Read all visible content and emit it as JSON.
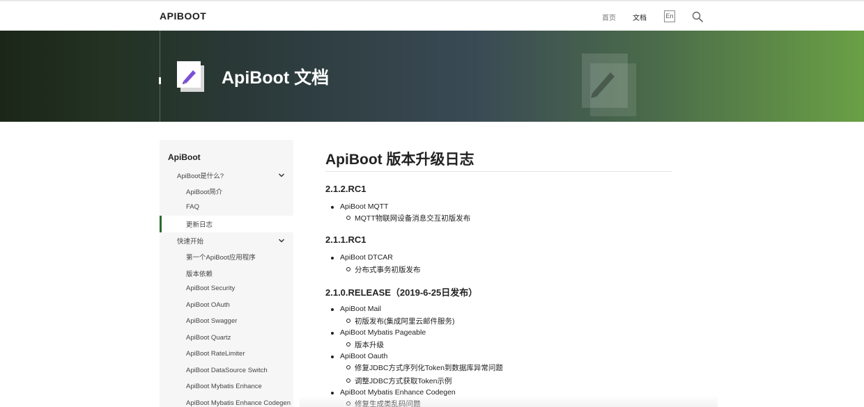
{
  "nav": {
    "logo": "APIBOOT",
    "links": [
      "首页",
      "文档"
    ],
    "lang": "En"
  },
  "banner": {
    "title": "ApiBoot 文档"
  },
  "sidebar": {
    "title": "ApiBoot",
    "groups": [
      {
        "label": "ApiBoot是什么?",
        "items": [
          "ApiBoot简介",
          "FAQ",
          "更新日志"
        ]
      },
      {
        "label": "快速开始",
        "items": [
          "第一个ApiBoot应用程序",
          "版本依赖",
          "ApiBoot Security",
          "ApiBoot OAuth",
          "ApiBoot Swagger",
          "ApiBoot Quartz",
          "ApiBoot RateLimiter",
          "ApiBoot DataSource Switch",
          "ApiBoot Mybatis Enhance",
          "ApiBoot Mybatis Enhance Codegen"
        ]
      }
    ],
    "active_item": "更新日志"
  },
  "content": {
    "title": "ApiBoot 版本升级日志",
    "sections": [
      {
        "heading": "2.1.2.RC1",
        "items": [
          {
            "label": "ApiBoot MQTT",
            "sub": [
              "MQTT物联网设备消息交互初版发布"
            ]
          }
        ]
      },
      {
        "heading": "2.1.1.RC1",
        "items": [
          {
            "label": "ApiBoot DTCAR",
            "sub": [
              "分布式事务初版发布"
            ]
          }
        ]
      },
      {
        "heading": "2.1.0.RELEASE（2019-6-25日发布）",
        "items": [
          {
            "label": "ApiBoot Mail",
            "sub": [
              "初版发布(集成阿里云邮件服务)"
            ]
          },
          {
            "label": "ApiBoot Mybatis Pageable",
            "sub": [
              "版本升级"
            ]
          },
          {
            "label": "ApiBoot Oauth",
            "sub": [
              "修复JDBC方式序列化Token到数据库异常问题",
              "调整JDBC方式获取Token示例"
            ]
          },
          {
            "label": "ApiBoot Mybatis Enhance Codegen",
            "sub": [
              "修复生成类乱码问题"
            ]
          }
        ]
      }
    ]
  },
  "colors": {
    "active_bar": "#2e6b2e",
    "banner_left": "#1b2618",
    "banner_right": "#6aa045"
  }
}
